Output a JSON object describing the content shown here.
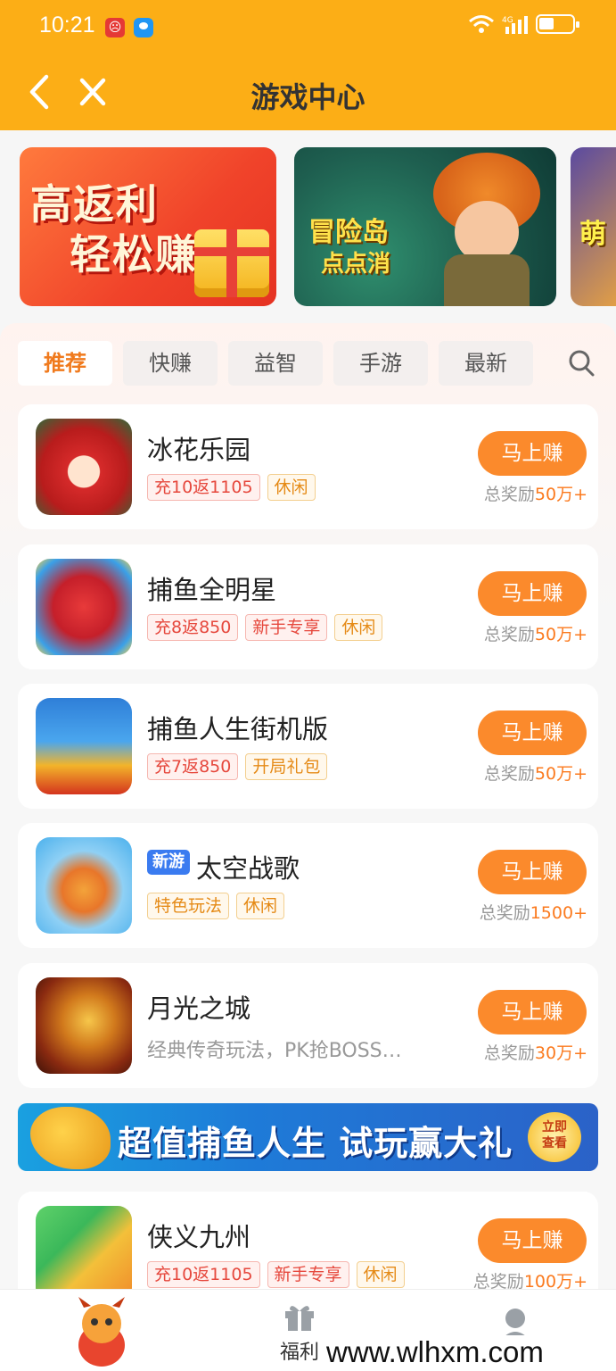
{
  "status_bar": {
    "time": "10:21",
    "network": "4G"
  },
  "header": {
    "title": "游戏中心"
  },
  "banners": [
    {
      "line1": "高返利",
      "line2": "轻松赚"
    },
    {
      "title": "冒险岛",
      "subtitle": "点点消"
    },
    {
      "title": "萌"
    }
  ],
  "tabs": [
    "推荐",
    "快赚",
    "益智",
    "手游",
    "最新"
  ],
  "games": [
    {
      "name": "冰花乐园",
      "tags": [
        {
          "text": "充10返1105",
          "style": "red"
        },
        {
          "text": "休闲",
          "style": "orange"
        }
      ],
      "button": "马上赚",
      "reward_label": "总奖励",
      "reward_amount": "50万+"
    },
    {
      "name": "捕鱼全明星",
      "tags": [
        {
          "text": "充8返850",
          "style": "red"
        },
        {
          "text": "新手专享",
          "style": "red"
        },
        {
          "text": "休闲",
          "style": "orange"
        }
      ],
      "button": "马上赚",
      "reward_label": "总奖励",
      "reward_amount": "50万+"
    },
    {
      "name": "捕鱼人生街机版",
      "tags": [
        {
          "text": "充7返850",
          "style": "red"
        },
        {
          "text": "开局礼包",
          "style": "orange"
        }
      ],
      "button": "马上赚",
      "reward_label": "总奖励",
      "reward_amount": "50万+"
    },
    {
      "badge": "新游",
      "name": "太空战歌",
      "tags": [
        {
          "text": "特色玩法",
          "style": "orange"
        },
        {
          "text": "休闲",
          "style": "orange"
        }
      ],
      "button": "马上赚",
      "reward_label": "总奖励",
      "reward_amount": "1500+"
    },
    {
      "name": "月光之城",
      "description": "经典传奇玩法，PK抢BOSS…",
      "button": "马上赚",
      "reward_label": "总奖励",
      "reward_amount": "30万+"
    },
    {
      "name": "侠义九州",
      "tags": [
        {
          "text": "充10返1105",
          "style": "red"
        },
        {
          "text": "新手专享",
          "style": "red"
        },
        {
          "text": "休闲",
          "style": "orange"
        }
      ],
      "button": "马上赚",
      "reward_label": "总奖励",
      "reward_amount": "100万+"
    }
  ],
  "promo": {
    "text": "超值捕鱼人生 试玩赢大礼",
    "cta_line1": "立即",
    "cta_line2": "查看"
  },
  "bottom_nav": {
    "fuli_label": "福利"
  },
  "watermark": "www.wlhxm.com"
}
